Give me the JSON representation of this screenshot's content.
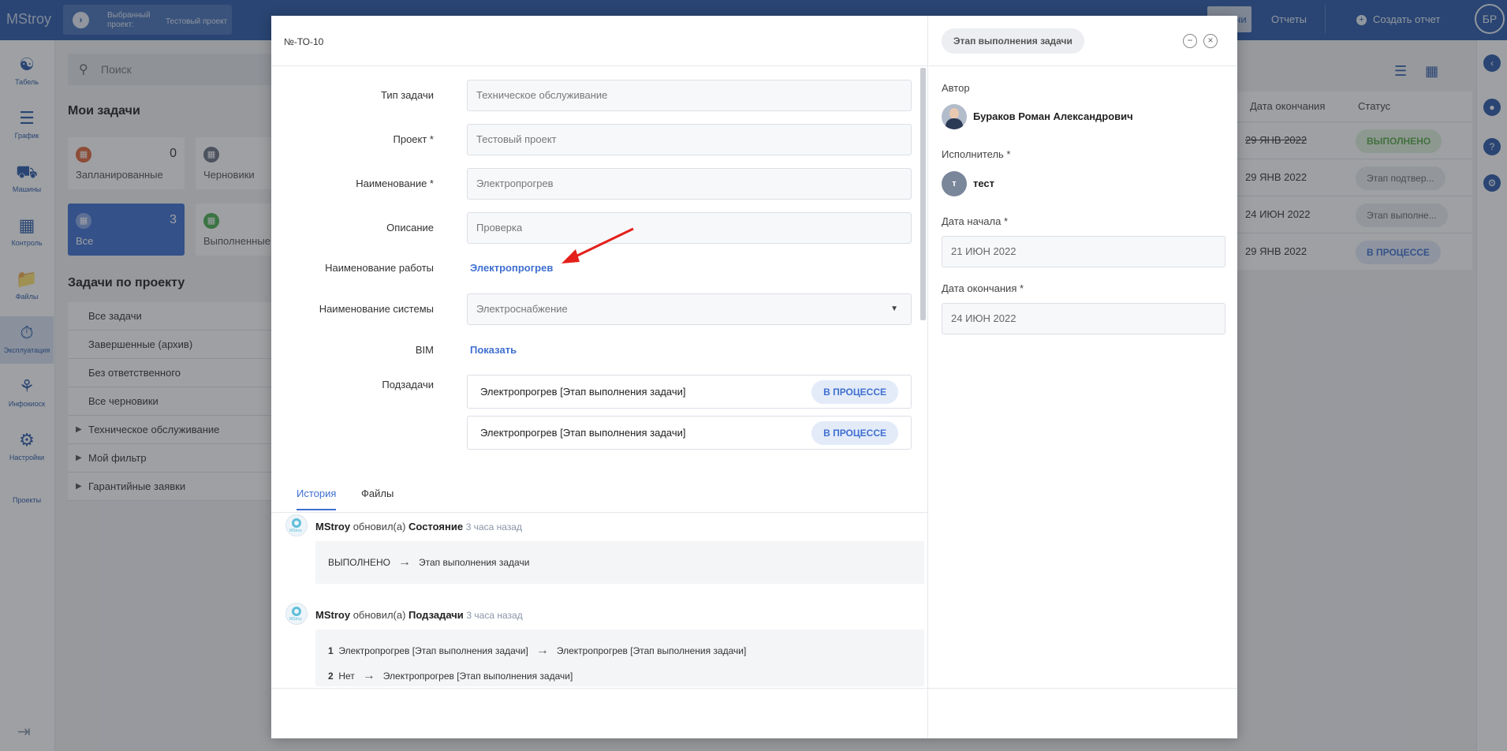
{
  "topbar": {
    "logo": "MStroy",
    "project_label": "Выбранный проект:",
    "project_value": "Тестовый проект",
    "tasks_label": "Задачи",
    "reports_label": "Отчеты",
    "create_report_label": "Создать отчет",
    "avatar_initials": "БР",
    "colors": {
      "bar": "#2d5aa8",
      "accent": "#3f6fd0"
    }
  },
  "leftnav": {
    "items": [
      {
        "label": "Табель",
        "icon": "people-icon"
      },
      {
        "label": "График",
        "icon": "schedule-icon"
      },
      {
        "label": "Машины",
        "icon": "truck-icon"
      },
      {
        "label": "Контроль",
        "icon": "control-icon"
      },
      {
        "label": "Файлы",
        "icon": "folder-icon"
      },
      {
        "label": "Эксплуатация",
        "icon": "stopwatch-icon"
      },
      {
        "label": "Инфокиоск",
        "icon": "kiosk-icon"
      },
      {
        "label": "Настройки",
        "icon": "gear-icon"
      },
      {
        "label": "Проекты",
        "icon": ""
      }
    ]
  },
  "background": {
    "search_placeholder": "Поиск",
    "my_tasks_title": "Мои задачи",
    "cards": [
      {
        "label": "Запланированные",
        "count": "0"
      },
      {
        "label": "Черновики",
        "count": ""
      },
      {
        "label": "Все",
        "count": "3"
      },
      {
        "label": "Выполненные",
        "count": ""
      }
    ],
    "project_tasks_title": "Задачи по проекту",
    "filters": [
      "Все задачи",
      "Завершенные (архив)",
      "Без ответственного",
      "Все черновики",
      "Техническое обслуживание",
      "Мой фильтр",
      "Гарантийные заявки"
    ],
    "table": {
      "headers": [
        "Дата окончания",
        "Статус"
      ],
      "rows": [
        {
          "date": "29 ЯНВ 2022",
          "status": "ВЫПОЛНЕНО"
        },
        {
          "date": "29 ЯНВ 2022",
          "status": "Этап подтвер..."
        },
        {
          "date": "24 ИЮН 2022",
          "status": "Этап выполне..."
        },
        {
          "date": "29 ЯНВ 2022",
          "status": "В ПРОЦЕССЕ"
        }
      ]
    }
  },
  "modal": {
    "task_id": "№-ТО-10",
    "fields": {
      "task_type": {
        "label": "Тип задачи",
        "value": "Техническое обслуживание"
      },
      "project": {
        "label": "Проект *",
        "value": "Тестовый проект"
      },
      "name": {
        "label": "Наименование *",
        "value": "Электропрогрев"
      },
      "description": {
        "label": "Описание",
        "value": "Проверка"
      },
      "work_name": {
        "label": "Наименование работы",
        "value": "Электропрогрев"
      },
      "system_name": {
        "label": "Наименование системы",
        "value": "Электроснабжение"
      },
      "bim": {
        "label": "BIM",
        "value": "Показать"
      },
      "subtasks_label": "Подзадачи"
    },
    "subtasks": [
      {
        "title": "Электропрогрев [Этап выполнения  задачи]",
        "status": "В ПРОЦЕССЕ"
      },
      {
        "title": "Электропрогрев [Этап выполнения  задачи]",
        "status": "В ПРОЦЕССЕ"
      }
    ],
    "tabs": [
      "История",
      "Файлы"
    ],
    "history": [
      {
        "author": "MStroy",
        "action": "обновил(а)",
        "field": "Состояние",
        "ago": "3 часа назад",
        "from": "ВЫПОЛНЕНО",
        "to": "Этап выполнения  задачи"
      },
      {
        "author": "MStroy",
        "action": "обновил(а)",
        "field": "Подзадачи",
        "ago": "3 часа назад",
        "rows": [
          {
            "n": "1",
            "from": "Электропрогрев [Этап выполнения  задачи]",
            "to": "Электропрогрев [Этап выполнения  задачи]"
          },
          {
            "n": "2",
            "from": "Нет",
            "to": "Электропрогрев [Этап выполнения  задачи]"
          }
        ]
      }
    ],
    "side": {
      "stage_badge": "Этап выполнения  задачи",
      "author_label": "Автор",
      "author_name": "Бураков Роман Александрович",
      "assignee_label": "Исполнитель *",
      "assignee_initial": "т",
      "assignee_name": "тест",
      "start_label": "Дата начала *",
      "start_value": "21 ИЮН 2022",
      "end_label": "Дата окончания *",
      "end_value": "24 ИЮН 2022"
    }
  }
}
